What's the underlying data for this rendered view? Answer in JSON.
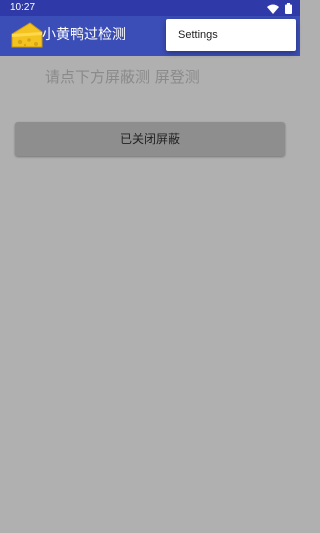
{
  "status_bar": {
    "time": "10:27",
    "icons": [
      "wifi-icon",
      "battery-icon"
    ]
  },
  "app_bar": {
    "title": "小黄鸭过检测",
    "logo_icon": "cheese-icon",
    "color": "#3b4eb7"
  },
  "overflow_menu": {
    "items": [
      {
        "label": "Settings"
      }
    ]
  },
  "main": {
    "hint": "请点下方屏蔽测 屏登测",
    "toggle_button_label": "已关闭屏蔽"
  },
  "colors": {
    "status_bar": "#2f3aa8",
    "background": "#b0b0b0",
    "button": "#8e8e8e"
  }
}
